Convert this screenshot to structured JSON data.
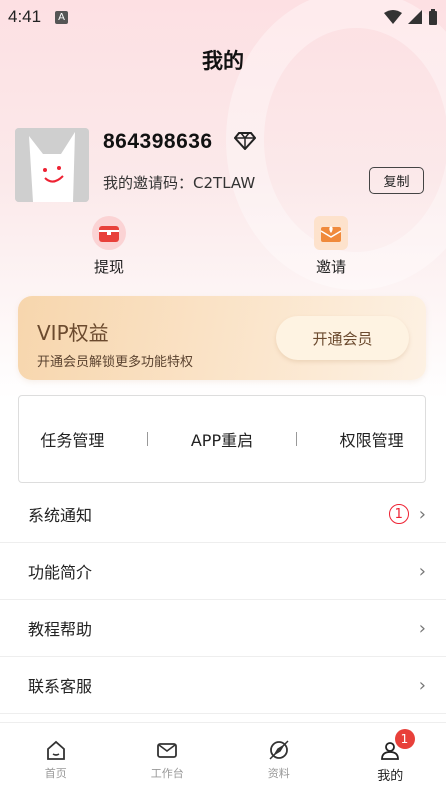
{
  "status_bar": {
    "time": "4:41",
    "notification_icon": "A"
  },
  "header": {
    "title": "我的"
  },
  "profile": {
    "user_id": "864398636",
    "invite_label": "我的邀请码：",
    "invite_code": "C2TLAW",
    "copy_label": "复制"
  },
  "quick_actions": [
    {
      "label": "提现",
      "icon": "wallet-icon",
      "color": "#e8403a"
    },
    {
      "label": "邀请",
      "icon": "gift-envelope-icon",
      "color": "#f08a3c"
    }
  ],
  "vip": {
    "title": "VIP权益",
    "subtitle": "开通会员解锁更多功能特权",
    "button": "开通会员"
  },
  "tools": [
    "任务管理",
    "APP重启",
    "权限管理"
  ],
  "menu": [
    {
      "label": "系统通知",
      "badge": "1"
    },
    {
      "label": "功能简介"
    },
    {
      "label": "教程帮助"
    },
    {
      "label": "联系客服"
    }
  ],
  "tabs": [
    {
      "label": "首页",
      "icon": "home-icon"
    },
    {
      "label": "工作台",
      "icon": "mail-icon"
    },
    {
      "label": "资料",
      "icon": "compass-icon"
    },
    {
      "label": "我的",
      "icon": "user-icon",
      "badge": "1"
    }
  ],
  "colors": {
    "accent": "#e8403a",
    "vip_text": "#6b4a2e"
  }
}
